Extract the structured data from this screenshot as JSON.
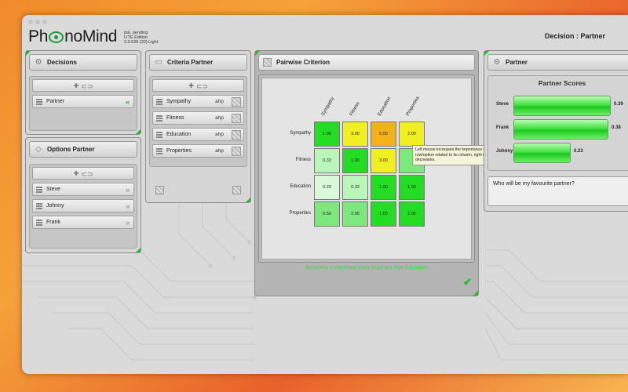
{
  "app": {
    "name_prefix": "Ph",
    "name_suffix": "noMind",
    "meta": [
      "pat. pending",
      "LITE Edition",
      "3.0.628 (20)  Light"
    ],
    "window_title": "Decision : Partner"
  },
  "decisions": {
    "title": "Decisions",
    "items": [
      {
        "label": "Partner"
      }
    ]
  },
  "options": {
    "title": "Options Partner",
    "items": [
      {
        "label": "Steve"
      },
      {
        "label": "Johnny"
      },
      {
        "label": "Frank"
      }
    ]
  },
  "criteria": {
    "title": "Criteria Partner",
    "items": [
      {
        "label": "Sympathy",
        "method": "ahp"
      },
      {
        "label": "Fitness",
        "method": "ahp"
      },
      {
        "label": "Education",
        "method": "ahp"
      },
      {
        "label": "Properties",
        "method": "ahp"
      }
    ]
  },
  "pairwise": {
    "title": "Pairwise Criterion",
    "columns": [
      "Sympathy",
      "Fitness",
      "Education",
      "Properties"
    ],
    "rows": [
      {
        "label": "Sympathy",
        "cells": [
          "1.00",
          "3.00",
          "5.00",
          "2.00"
        ]
      },
      {
        "label": "Fitness",
        "cells": [
          "0.33",
          "1.00",
          "3.00",
          ""
        ]
      },
      {
        "label": "Education",
        "cells": [
          "0.20",
          "0.33",
          "1.00",
          "1.00"
        ]
      },
      {
        "label": "Properties",
        "cells": [
          "0.50",
          "2.00",
          "1.00",
          "1.00"
        ]
      }
    ],
    "cell_colors": [
      [
        "#22dd22",
        "#f0f020",
        "#f5b218",
        "#f0f020"
      ],
      [
        "#baf5ba",
        "#22dd22",
        "#f0f020",
        "#7de87d"
      ],
      [
        "#d9f9d9",
        "#baf5ba",
        "#22dd22",
        "#22dd22"
      ],
      [
        "#7de87d",
        "#7de87d",
        "#22dd22",
        "#22dd22"
      ]
    ],
    "tooltip": "Left mouse increases the importance of this row/option related to its column, right mouse decreases.",
    "status": "Sympathy is extremely more important than Education"
  },
  "scores": {
    "panel_title": "Partner",
    "title": "Partner Scores",
    "items": [
      {
        "name": "Steve",
        "value": 0.39,
        "display": "0.39"
      },
      {
        "name": "Frank",
        "value": 0.38,
        "display": "0.38"
      },
      {
        "name": "Johnny",
        "value": 0.23,
        "display": "0.23"
      }
    ],
    "question": "Who will be my favourite partner?"
  },
  "colors": {
    "accent_green": "#2bb52b",
    "status_green": "#3cd63c"
  }
}
